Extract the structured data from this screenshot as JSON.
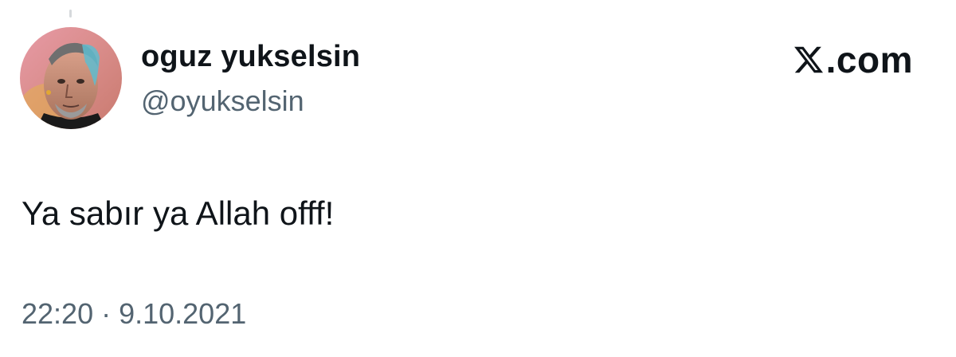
{
  "author": {
    "display_name": "oguz yukselsin",
    "handle": "@oyukselsin",
    "avatar": "avatar-portrait"
  },
  "brand": {
    "logo_icon": "x-logo-icon",
    "text": ".com"
  },
  "tweet": {
    "text": "Ya sabır ya Allah offf!",
    "time": "22:20",
    "separator": "·",
    "date": "9.10.2021"
  },
  "colors": {
    "primary_text": "#0f1419",
    "secondary_text": "#536471",
    "background": "#ffffff"
  }
}
